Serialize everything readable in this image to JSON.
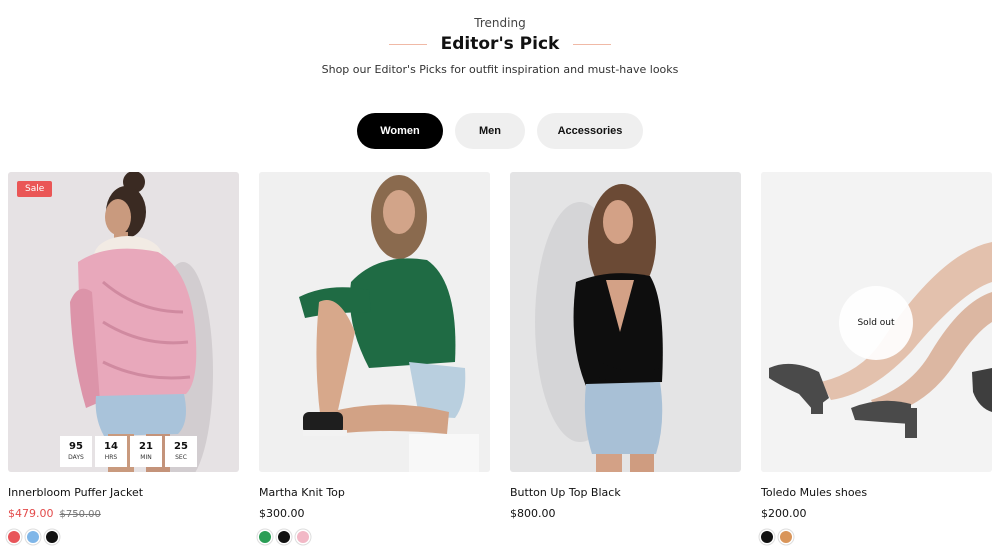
{
  "header": {
    "eyebrow": "Trending",
    "title": "Editor's Pick",
    "subtitle": "Shop our Editor's Picks for outfit inspiration and must-have looks"
  },
  "tabs": [
    {
      "label": "Women",
      "active": true
    },
    {
      "label": "Men",
      "active": false
    },
    {
      "label": "Accessories",
      "active": false
    }
  ],
  "products": [
    {
      "name": "Innerbloom Puffer Jacket",
      "price": "$479.00",
      "old_price": "$750.00",
      "badge": "Sale",
      "countdown": [
        {
          "value": "95",
          "unit": "DAYS"
        },
        {
          "value": "14",
          "unit": "HRS"
        },
        {
          "value": "21",
          "unit": "MIN"
        },
        {
          "value": "25",
          "unit": "SEC"
        }
      ],
      "swatches": [
        "#e8555a",
        "#7fb6e8",
        "#111111"
      ]
    },
    {
      "name": "Martha Knit Top",
      "price": "$300.00",
      "swatches": [
        "#2a9d55",
        "#111111",
        "#f2b8c6"
      ]
    },
    {
      "name": "Button Up Top Black",
      "price": "$800.00",
      "swatches": []
    },
    {
      "name": "Toledo Mules shoes",
      "price": "$200.00",
      "status": "Sold out",
      "swatches": [
        "#111111",
        "#d9955a"
      ]
    }
  ],
  "colors": {
    "accent_rule": "#f0b9a6",
    "sale_red": "#ea5656",
    "active_tab": "#000000"
  }
}
